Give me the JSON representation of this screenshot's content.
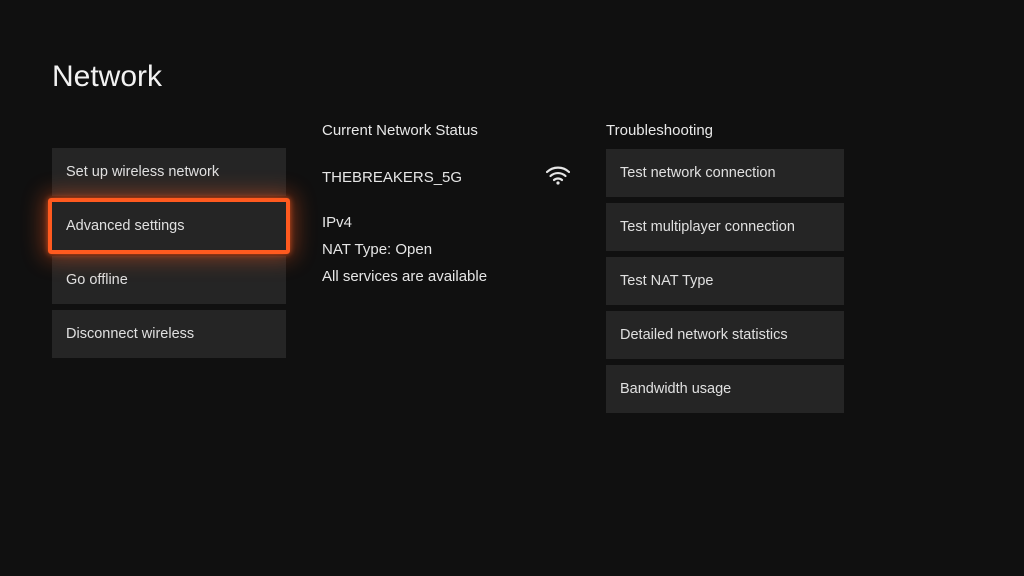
{
  "page_title": "Network",
  "left_nav": {
    "items": [
      {
        "label": "Set up wireless network"
      },
      {
        "label": "Advanced settings",
        "selected": true
      },
      {
        "label": "Go offline"
      },
      {
        "label": "Disconnect wireless"
      }
    ]
  },
  "status": {
    "header": "Current Network Status",
    "network_name": "THEBREAKERS_5G",
    "signal_icon": "wifi-icon",
    "ip_version": "IPv4",
    "nat_line": "NAT Type: Open",
    "services_line": "All services are available"
  },
  "troubleshooting": {
    "header": "Troubleshooting",
    "items": [
      {
        "label": "Test network connection"
      },
      {
        "label": "Test multiplayer connection"
      },
      {
        "label": "Test NAT Type"
      },
      {
        "label": "Detailed network statistics"
      },
      {
        "label": "Bandwidth usage"
      }
    ]
  }
}
